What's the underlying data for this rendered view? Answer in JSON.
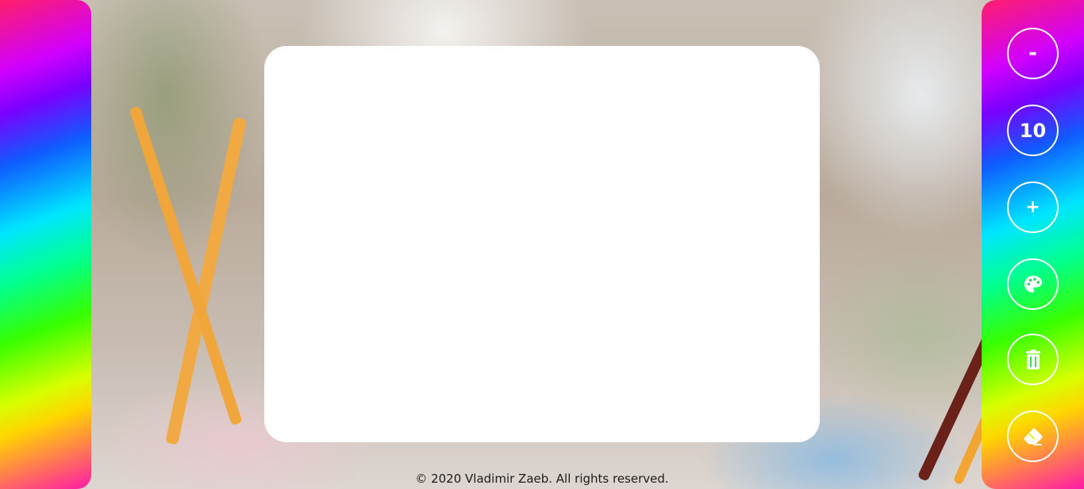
{
  "colors": {
    "canvas_bg": "#ffffff",
    "button_border": "#ffffff",
    "button_text": "#ffffff"
  },
  "toolbar": {
    "decrease_label": "-",
    "brush_size": "10",
    "increase_label": "+",
    "palette_icon": "palette-icon",
    "clear_icon": "trash-icon",
    "eraser_icon": "eraser-icon"
  },
  "footer": {
    "copyright": "© 2020 Vladimir Zaeb. All rights reserved."
  }
}
